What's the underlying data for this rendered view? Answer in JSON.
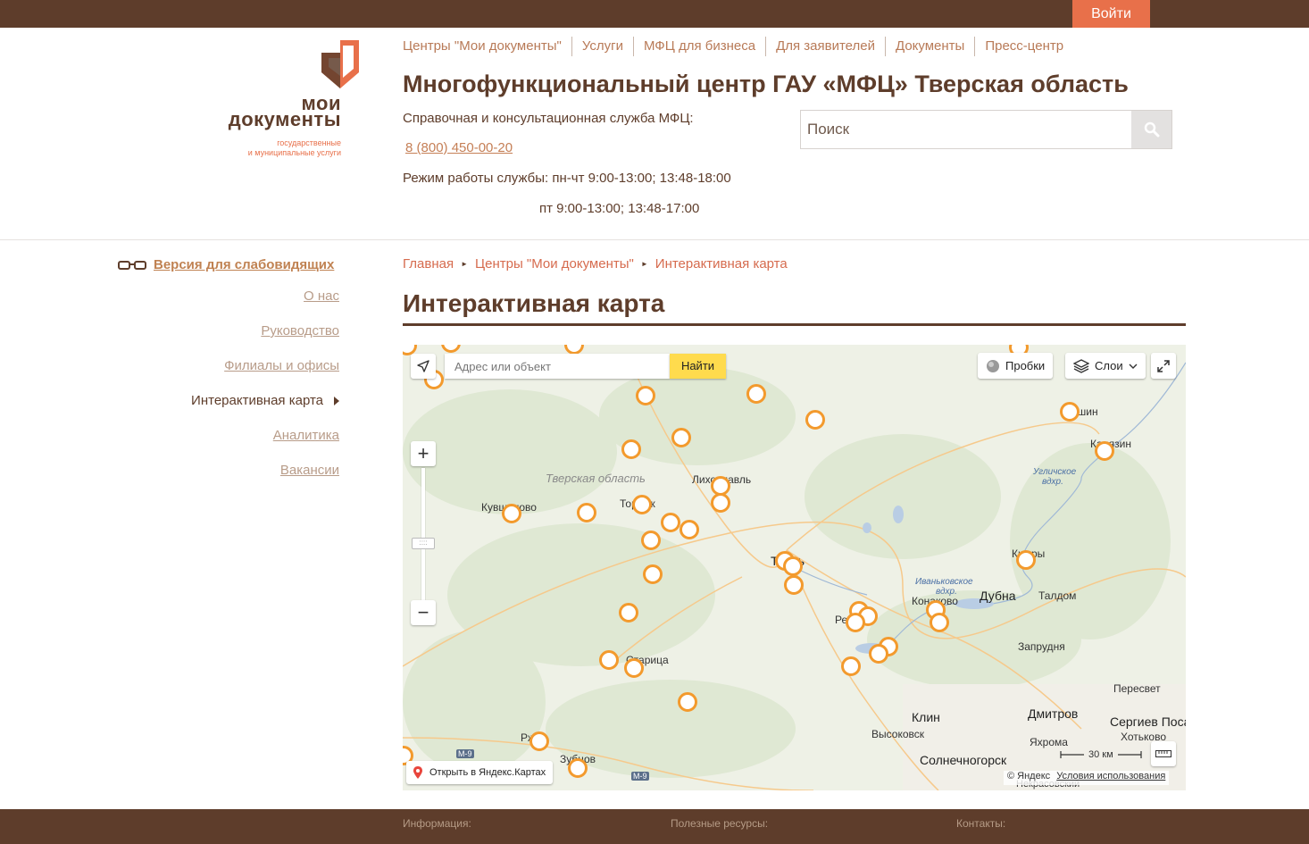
{
  "topbar": {
    "login_label": "Войти"
  },
  "logo": {
    "line1": "мои",
    "line2": "документы",
    "line3": "государственные",
    "line4": "и муниципальные услуги",
    "colors": {
      "brown": "#5e3d2b",
      "orange": "#e8704a"
    }
  },
  "nav": {
    "items": [
      "Центры \"Мои документы\"",
      "Услуги",
      "МФЦ для бизнеса",
      "Для заявителей",
      "Документы",
      "Пресс-центр"
    ]
  },
  "header": {
    "title": "Многофункциональный центр ГАУ «МФЦ» Тверская область",
    "help_label": "Справочная и консультационная служба МФЦ:",
    "phone": "8 (800) 450-00-20",
    "hours_line1": "Режим работы службы: пн-чт 9:00-13:00; 13:48-18:00",
    "hours_line2": "пт 9:00-13:00; 13:48-17:00",
    "search_placeholder": "Поиск",
    "search_icon": "search-icon"
  },
  "sidebar": {
    "low_vision_label": "Версия для слабовидящих",
    "low_vision_icon": "glasses-icon",
    "items": [
      {
        "label": "О нас",
        "active": false
      },
      {
        "label": "Руководство",
        "active": false
      },
      {
        "label": "Филиалы и офисы",
        "active": false
      },
      {
        "label": "Интерактивная карта",
        "active": true
      },
      {
        "label": "Аналитика",
        "active": false
      },
      {
        "label": "Вакансии",
        "active": false
      }
    ]
  },
  "breadcrumbs": [
    "Главная",
    "Центры \"Мои документы\"",
    "Интерактивная карта"
  ],
  "page": {
    "title": "Интерактивная карта"
  },
  "map": {
    "search_placeholder": "Адрес или объект",
    "find_label": "Найти",
    "traffic_label": "Пробки",
    "layers_label": "Слои",
    "open_label": "Открыть в Яндекс.Картах",
    "scale_label": "30 км",
    "copyright": "© Яндекс",
    "terms_label": "Условия использования",
    "marker_color": "#f39a2d",
    "region_label": "Тверская область",
    "water_labels": {
      "uglich_1": "Угличское",
      "uglich_2": "вдхр.",
      "ivan_1": "Иваньковское",
      "ivan_2": "вдхр."
    },
    "roads": [
      "М-9",
      "М-9"
    ],
    "cities": {
      "lihoslavl": "Лихославль",
      "kuvshinovo": "Кувшиново",
      "torzhok": "Торжок",
      "tver": "Тверь",
      "kashin": "Кашин",
      "kimry": "Кимры",
      "dubna": "Дубна",
      "taldom": "Талдом",
      "konakovo": "Конаково",
      "zaprudnya": "Запрудня",
      "peresvet": "Пересвет",
      "dmitrov": "Дмитров",
      "sergiev": "Сергиев Посад",
      "hotkovo": "Хотьково",
      "yakhroma": "Яхрома",
      "klin": "Клин",
      "vysokovsk": "Высоковск",
      "solnechnogorsk": "Солнечногорск",
      "nekrasovsky": "Некрасовский",
      "staritsa": "Старица",
      "rzhev": "Ржев",
      "zubtsov": "Зубцов",
      "redkino": "Редкино",
      "kalyazin": "Калязин"
    }
  },
  "footer": {
    "info": "Информация:",
    "resources": "Полезные ресурсы:",
    "contacts": "Контакты:"
  }
}
